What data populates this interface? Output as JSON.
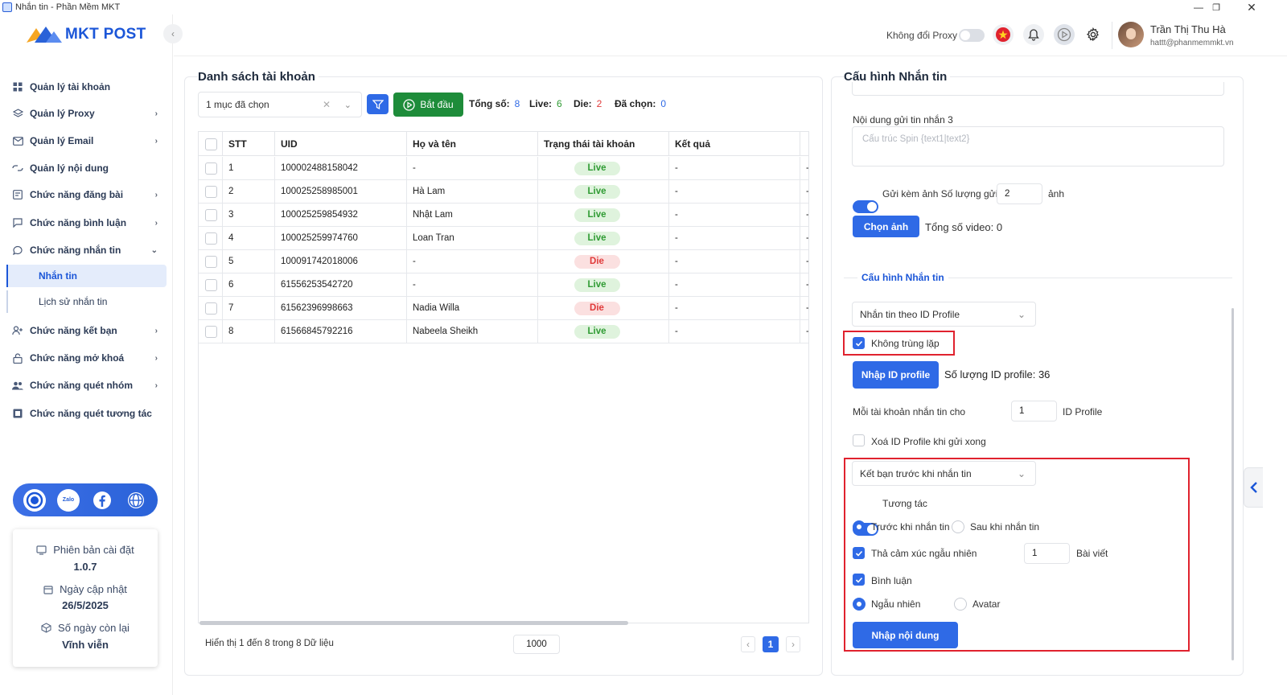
{
  "window": {
    "title": "Nhắn tin - Phần Mềm MKT"
  },
  "logo": {
    "text": "MKT POST"
  },
  "sidebar": {
    "items": [
      {
        "label": "Quản lý tài khoản",
        "icon": "grid-icon",
        "chevron": false
      },
      {
        "label": "Quản lý Proxy",
        "icon": "layers-icon",
        "chevron": true
      },
      {
        "label": "Quản lý Email",
        "icon": "mail-icon",
        "chevron": true
      },
      {
        "label": "Quản lý nội dung",
        "icon": "content-icon",
        "chevron": false
      },
      {
        "label": "Chức năng đăng bài",
        "icon": "post-icon",
        "chevron": true
      },
      {
        "label": "Chức năng bình luận",
        "icon": "comment-icon",
        "chevron": true
      },
      {
        "label": "Chức năng nhắn tin",
        "icon": "message-icon",
        "chevron": true,
        "expanded": true
      },
      {
        "label": "Chức năng kết bạn",
        "icon": "add-friend-icon",
        "chevron": true
      },
      {
        "label": "Chức năng mở khoá",
        "icon": "lock-icon",
        "chevron": true
      },
      {
        "label": "Chức năng quét nhóm",
        "icon": "group-icon",
        "chevron": true
      },
      {
        "label": "Chức năng quét tương tác",
        "icon": "scan-icon",
        "chevron": false
      }
    ],
    "subitems": [
      {
        "label": "Nhắn tin",
        "active": true
      },
      {
        "label": "Lịch sử nhắn tin",
        "active": false
      }
    ],
    "social": [
      "support-icon",
      "zalo-icon",
      "facebook-icon",
      "globe-icon"
    ],
    "zalo_text": "Zalo",
    "info": {
      "version_label": "Phiên bản cài đặt",
      "version_value": "1.0.7",
      "update_label": "Ngày cập nhật",
      "update_value": "26/5/2025",
      "days_label": "Số ngày còn lại",
      "days_value": "Vĩnh viễn"
    }
  },
  "header": {
    "proxy_label": "Không đổi Proxy",
    "proxy_toggle_on": false,
    "user_name": "Trần Thị Thu Hà",
    "user_email": "hattt@phanmemmkt.vn"
  },
  "accounts": {
    "title": "Danh sách tài khoản",
    "select_value": "1 mục đã chọn",
    "start_label": "Bắt đầu",
    "stats": {
      "total_label": "Tổng số:",
      "total": "8",
      "live_label": "Live:",
      "live": "6",
      "die_label": "Die:",
      "die": "2",
      "selected_label": "Đã chọn:",
      "selected": "0"
    },
    "columns": [
      "STT",
      "UID",
      "Họ và tên",
      "Trạng thái tài khoản",
      "Kết quả"
    ],
    "rows": [
      {
        "stt": "1",
        "uid": "100002488158042",
        "name": "-",
        "status": "Live",
        "result": "-"
      },
      {
        "stt": "2",
        "uid": "100025258985001",
        "name": "Hà Lam",
        "status": "Live",
        "result": "-"
      },
      {
        "stt": "3",
        "uid": "100025259854932",
        "name": "Nhật Lam",
        "status": "Live",
        "result": "-"
      },
      {
        "stt": "4",
        "uid": "100025259974760",
        "name": "Loan Tran",
        "status": "Live",
        "result": "-"
      },
      {
        "stt": "5",
        "uid": "100091742018006",
        "name": "-",
        "status": "Die",
        "result": "-"
      },
      {
        "stt": "6",
        "uid": "61556253542720",
        "name": "-",
        "status": "Live",
        "result": "-"
      },
      {
        "stt": "7",
        "uid": "61562396998663",
        "name": "Nadia Willa",
        "status": "Die",
        "result": "-"
      },
      {
        "stt": "8",
        "uid": "61566845792216",
        "name": "Nabeela Sheikh",
        "status": "Live",
        "result": "-"
      }
    ],
    "footer_text": "Hiển thị 1 đến 8 trong 8 Dữ liệu",
    "page_size": "1000",
    "current_page": "1",
    "prev": "‹",
    "next": "›"
  },
  "config": {
    "title": "Cấu hình Nhắn tin",
    "msg3_label": "Nội dung gửi tin nhắn 3",
    "msg3_placeholder": "Cấu trúc Spin {text1|text2}",
    "send_image_label": "Gửi kèm ảnh Số lượng gửi",
    "send_image_on": true,
    "image_count": "2",
    "image_unit": "ảnh",
    "choose_image": "Chọn ảnh",
    "total_video": "Tổng số video: 0",
    "section_label": "Cấu hình Nhắn tin",
    "mode_value": "Nhắn tin theo ID Profile",
    "no_duplicate_label": "Không trùng lặp",
    "no_duplicate_checked": true,
    "import_id_btn": "Nhập ID profile",
    "id_count": "Số lượng ID profile: 36",
    "per_account_label": "Mỗi tài khoản nhắn tin cho",
    "per_account_value": "1",
    "per_account_unit": "ID Profile",
    "delete_id_label": "Xoá ID Profile khi gửi xong",
    "delete_id_checked": false,
    "friend_mode_value": "Kết bạn trước khi nhắn tin",
    "interact_label": "Tương tác",
    "interact_on": true,
    "before_label": "Trước khi nhắn tin",
    "after_label": "Sau khi nhắn tin",
    "react_label": "Thả cảm xúc ngẫu nhiên",
    "react_count": "1",
    "react_unit": "Bài viết",
    "comment_label": "Bình luận",
    "random_label": "Ngẫu nhiên",
    "avatar_label": "Avatar",
    "import_content_btn": "Nhập nội dung"
  },
  "colors": {
    "accent": "#2f6ae6",
    "green": "#1e8c3a",
    "red_highlight": "#e0222e",
    "live": "#2f9b33",
    "die": "#e03b3b"
  }
}
